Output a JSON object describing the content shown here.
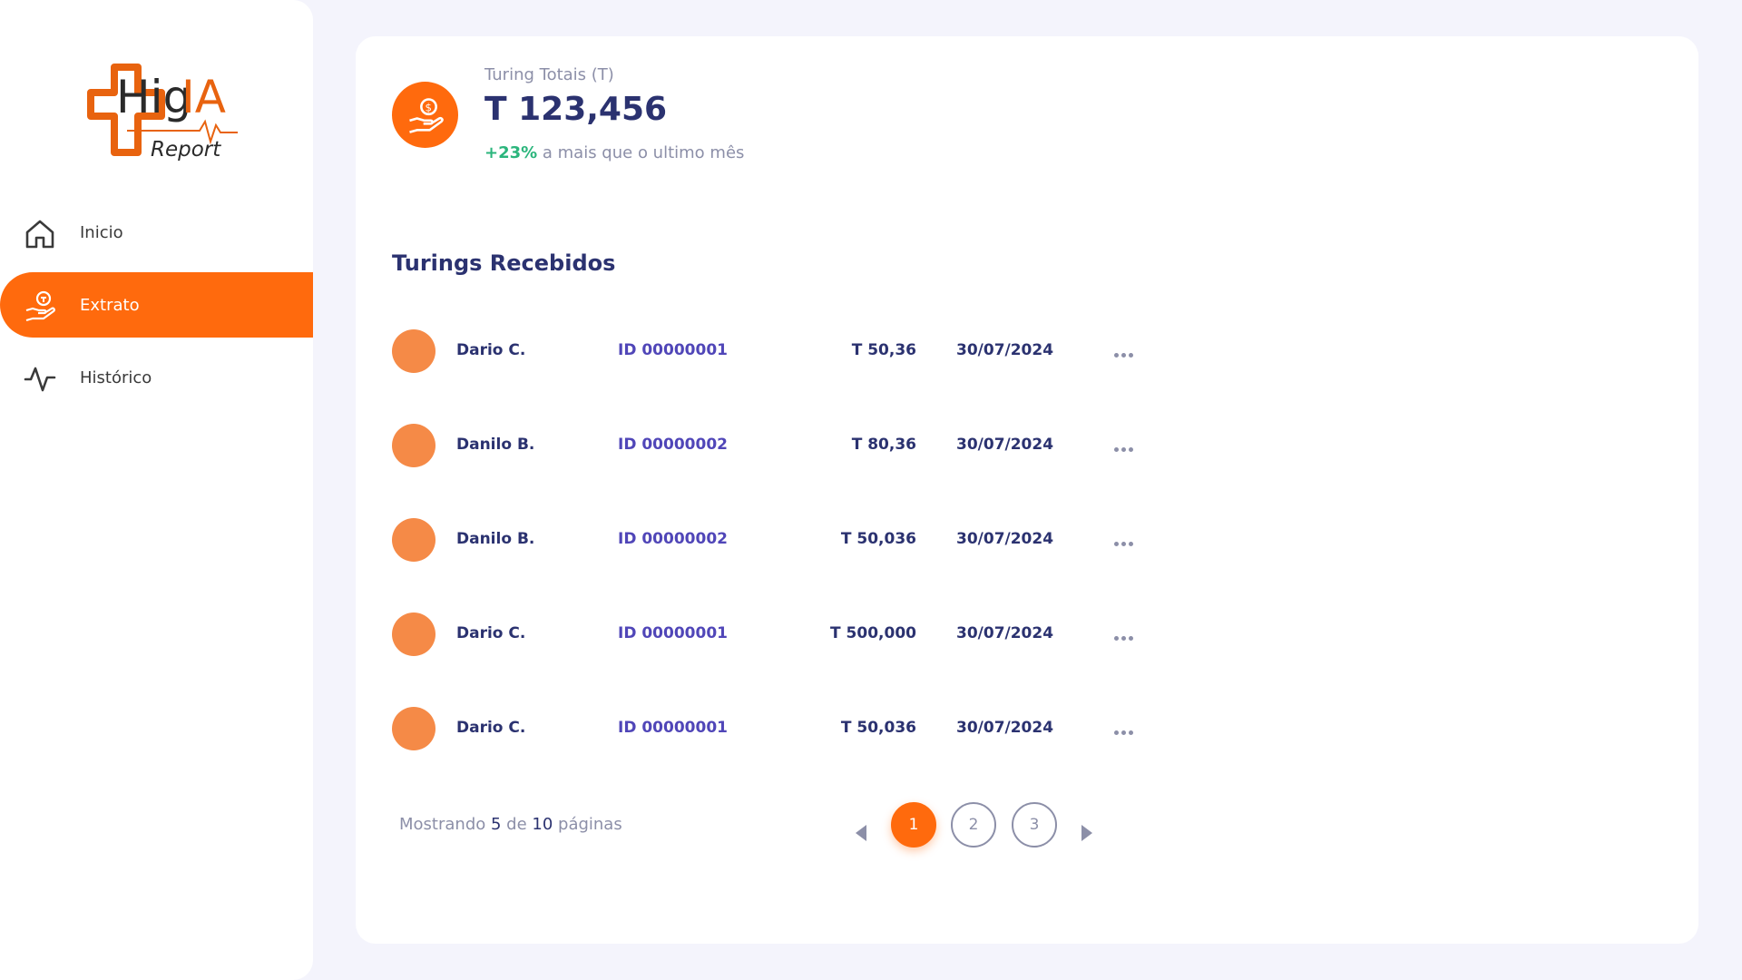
{
  "logo": {
    "brand": "HigIA",
    "text": "Report"
  },
  "sidebar": {
    "items": [
      {
        "label": "Inicio",
        "icon": "home-icon",
        "active": false
      },
      {
        "label": "Extrato",
        "icon": "hand-coin-icon",
        "active": true
      },
      {
        "label": "Histórico",
        "icon": "activity-icon",
        "active": false
      }
    ]
  },
  "summary": {
    "label": "Turing Totais (T)",
    "value": "T 123,456",
    "change_pct": "+23%",
    "change_text": " a mais que  o ultimo mês",
    "icon": "hand-coin-icon"
  },
  "section": {
    "title": "Turings Recebidos"
  },
  "transactions": [
    {
      "name": "Dario C.",
      "id": "ID 00000001",
      "amount": "T 50,36",
      "date": "30/07/2024"
    },
    {
      "name": "Danilo B.",
      "id": "ID 00000002",
      "amount": "T 80,36",
      "date": "30/07/2024"
    },
    {
      "name": "Danilo B.",
      "id": "ID 00000002",
      "amount": "T 50,036",
      "date": "30/07/2024"
    },
    {
      "name": "Dario C.",
      "id": "ID 00000001",
      "amount": "T 500,000",
      "date": "30/07/2024"
    },
    {
      "name": "Dario C.",
      "id": "ID 00000001",
      "amount": "T 50,036",
      "date": "30/07/2024"
    }
  ],
  "pagination": {
    "prefix": "Mostrando ",
    "shown": "5",
    "middle": " de ",
    "total": "10",
    "suffix": " páginas",
    "pages": [
      "1",
      "2",
      "3"
    ],
    "current": "1"
  },
  "colors": {
    "accent": "#ff6a0d",
    "navy": "#2b3270",
    "id_purple": "#5046b8",
    "positive": "#2bb57c",
    "muted": "#8c8fa8",
    "avatar": "#f58a47"
  }
}
